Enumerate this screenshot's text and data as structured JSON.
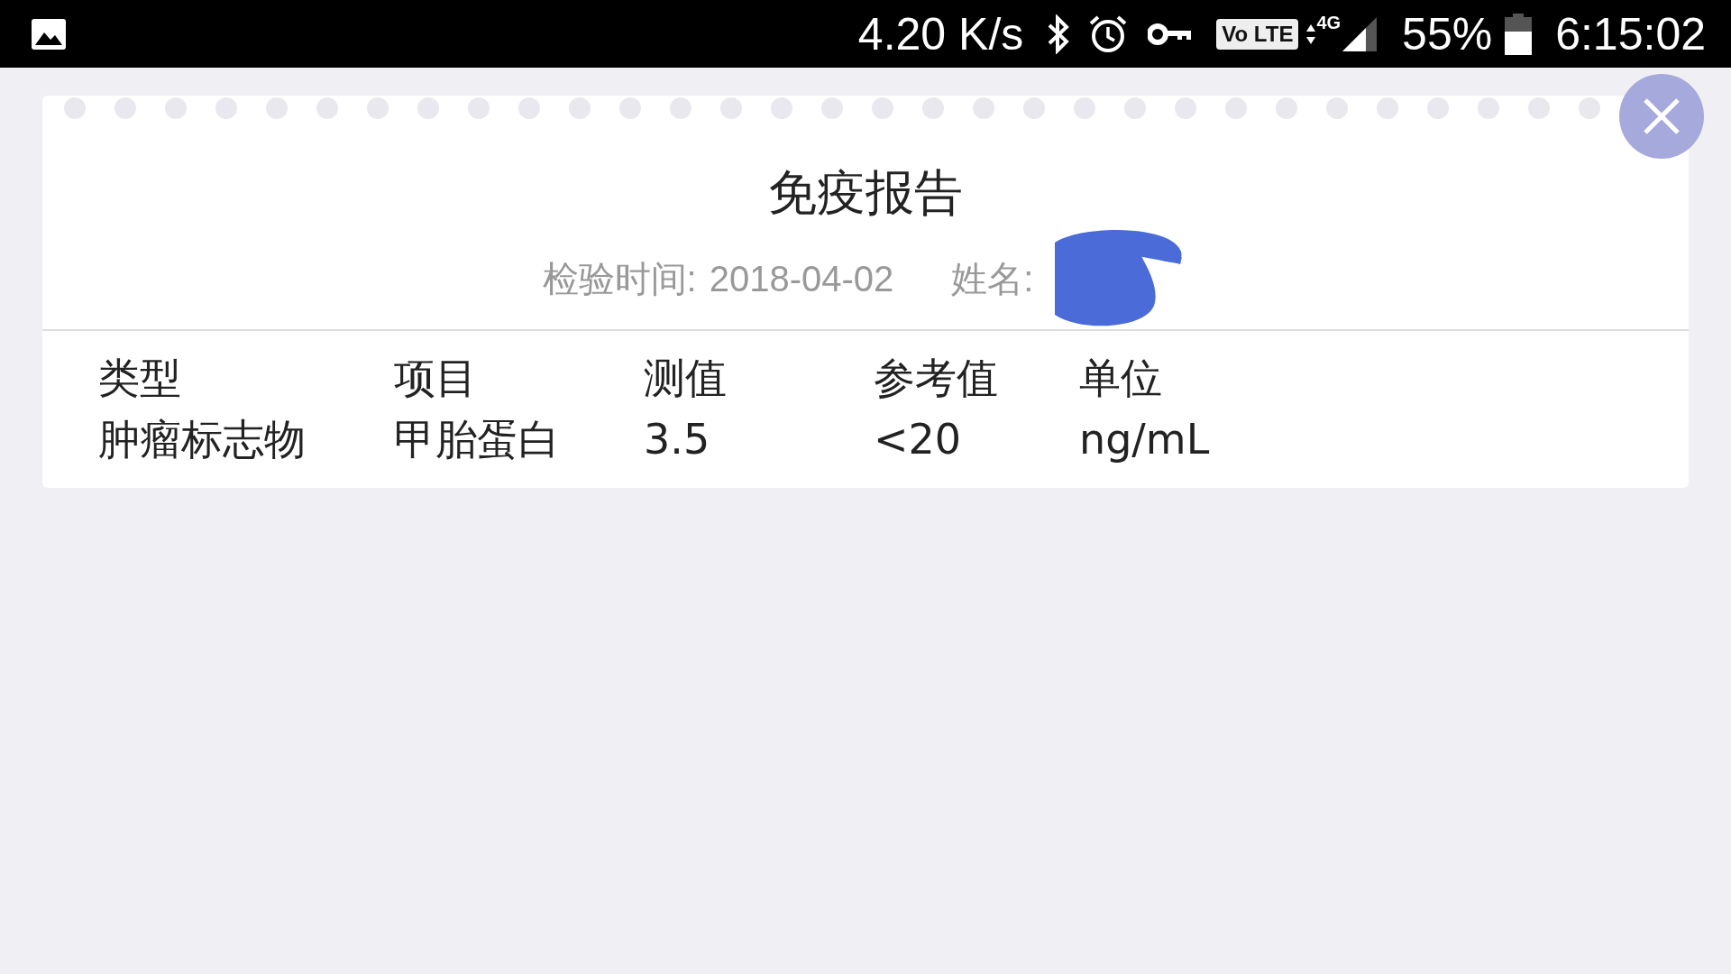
{
  "status_bar": {
    "speed": "4.20 K/s",
    "network_badge": "Vo LTE",
    "network_type": "4G",
    "battery": "55%",
    "time": "6:15:02"
  },
  "report": {
    "title": "免疫报告",
    "date_label": "检验时间:",
    "date": "2018-04-02",
    "name_label": "姓名:",
    "name_redacted": true,
    "table": {
      "columns": [
        "类型",
        "项目",
        "测值",
        "参考值",
        "单位"
      ],
      "rows": [
        [
          "肿瘤标志物",
          "甲胎蛋白",
          "3.5",
          "<20",
          "ng/mL"
        ]
      ]
    }
  }
}
